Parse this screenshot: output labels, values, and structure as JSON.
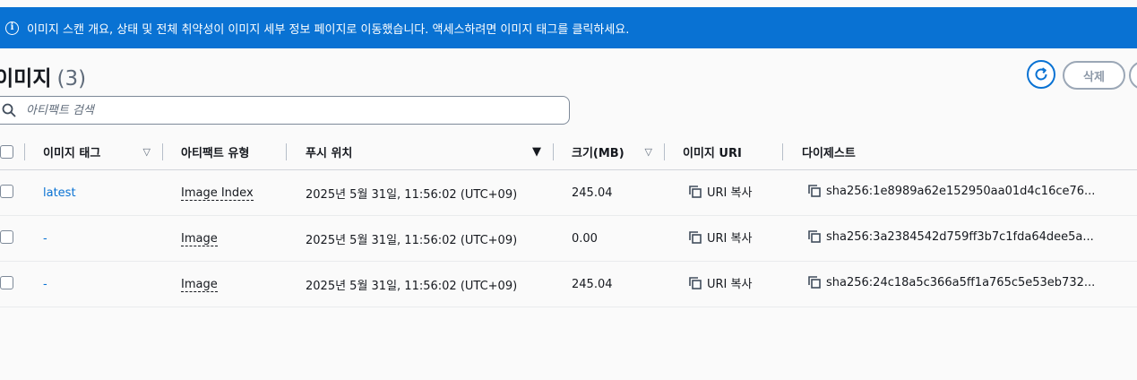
{
  "banner": {
    "icon": "info-icon",
    "text": "이미지 스캔 개요, 상태 및 전체 취약성이 이미지 세부 정보 페이지로 이동했습니다. 액세스하려면 이미지 태그를 클릭하세요."
  },
  "header": {
    "title": "이미지",
    "count": "(3)",
    "refresh_icon": "refresh-icon",
    "delete_label": "삭제"
  },
  "search": {
    "placeholder": "아티팩트 검색",
    "value": "",
    "icon": "search-icon"
  },
  "table": {
    "columns": [
      {
        "label": "이미지 태그",
        "sortable": true,
        "sort_active": false
      },
      {
        "label": "아티팩트 유형",
        "sortable": false,
        "sort_active": false
      },
      {
        "label": "푸시 위치",
        "sortable": true,
        "sort_active": true,
        "sort_direction": "descending"
      },
      {
        "label": "크기(MB)",
        "sortable": true,
        "sort_active": false
      },
      {
        "label": "이미지 URI",
        "sortable": false,
        "sort_active": false
      },
      {
        "label": "다이제스트",
        "sortable": false,
        "sort_active": false
      }
    ],
    "rows": [
      {
        "tag": "latest",
        "artifact_type": "Image Index",
        "pushed_at": "2025년 5월 31일, 11:56:02 (UTC+09)",
        "size": "245.04",
        "uri_label": "URI 복사",
        "digest": "sha256:1e8989a62e152950aa01d4c16ce76..."
      },
      {
        "tag": "-",
        "artifact_type": "Image",
        "pushed_at": "2025년 5월 31일, 11:56:02 (UTC+09)",
        "size": "0.00",
        "uri_label": "URI 복사",
        "digest": "sha256:3a2384542d759ff3b7c1fda64dee5a..."
      },
      {
        "tag": "-",
        "artifact_type": "Image",
        "pushed_at": "2025년 5월 31일, 11:56:02 (UTC+09)",
        "size": "245.04",
        "uri_label": "URI 복사",
        "digest": "sha256:24c18a5c366a5ff1a765c5e53eb732..."
      }
    ]
  },
  "colors": {
    "banner_bg": "#0972d3",
    "link": "#0972d3",
    "text": "#16191f",
    "muted": "#5f6b7a",
    "disabled_border": "#9ba7b6"
  }
}
